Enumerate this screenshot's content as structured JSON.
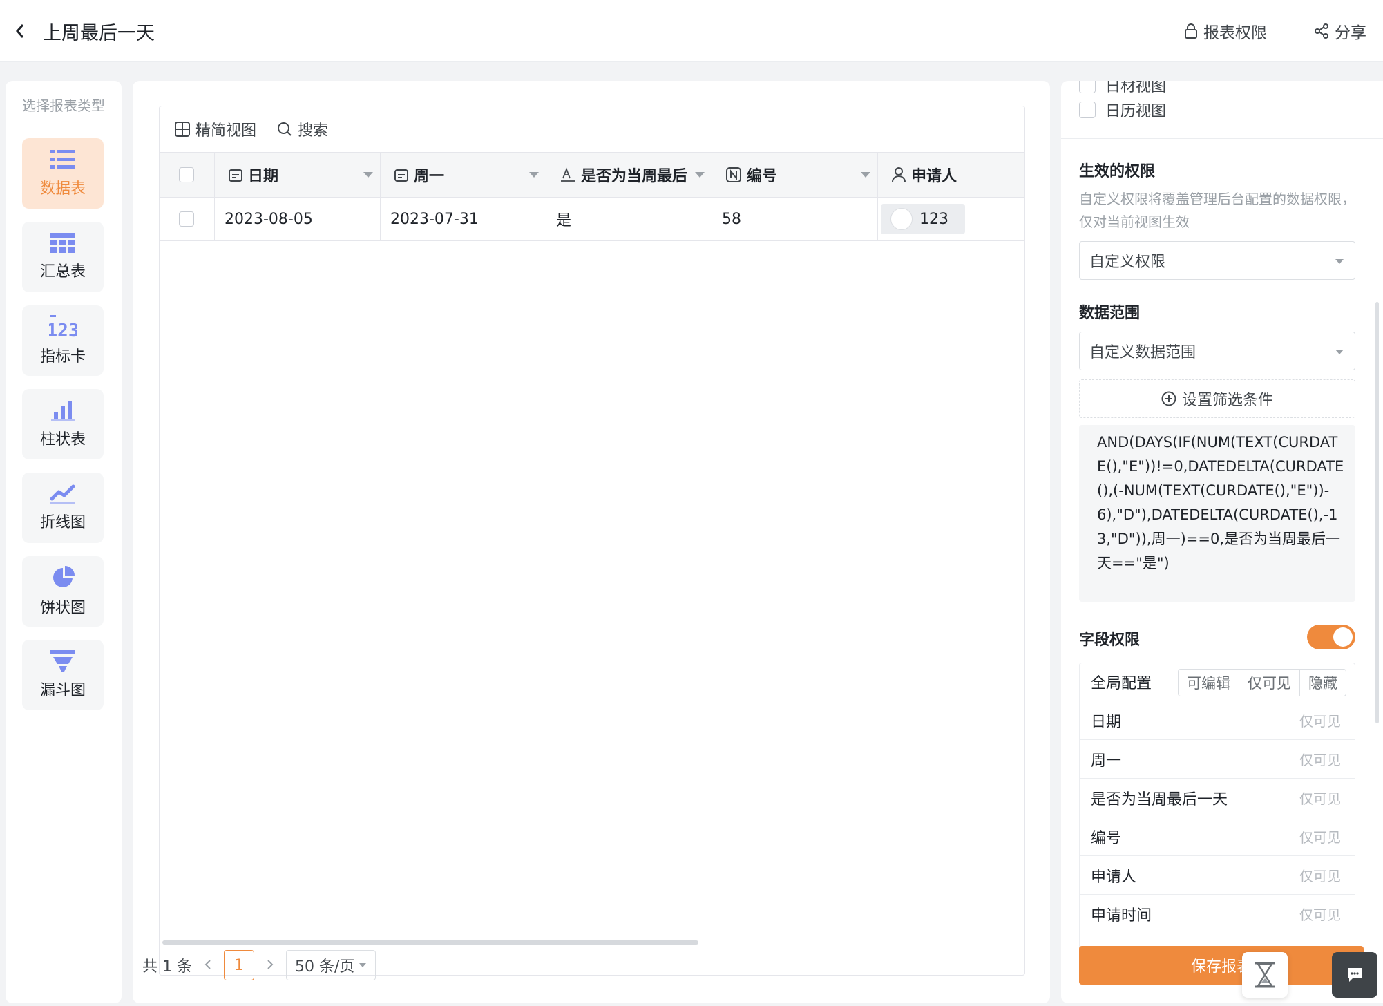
{
  "header": {
    "title": "上周最后一天",
    "report_permission_label": "报表权限",
    "share_label": "分享"
  },
  "sidebar": {
    "title": "选择报表类型",
    "items": [
      {
        "label": "数据表",
        "icon": "list-icon",
        "active": true
      },
      {
        "label": "汇总表",
        "icon": "table-icon",
        "active": false
      },
      {
        "label": "指标卡",
        "icon": "number-icon",
        "active": false
      },
      {
        "label": "柱状表",
        "icon": "bar-chart-icon",
        "active": false
      },
      {
        "label": "折线图",
        "icon": "line-chart-icon",
        "active": false
      },
      {
        "label": "饼状图",
        "icon": "pie-chart-icon",
        "active": false
      },
      {
        "label": "漏斗图",
        "icon": "funnel-icon",
        "active": false
      }
    ]
  },
  "toolbar": {
    "compact_view_label": "精简视图",
    "search_label": "搜索"
  },
  "table": {
    "columns": [
      {
        "label": "日期",
        "icon": "calendar-icon"
      },
      {
        "label": "周一",
        "icon": "calendar-icon"
      },
      {
        "label": "是否为当周最后",
        "icon": "text-icon"
      },
      {
        "label": "编号",
        "icon": "number-field-icon"
      },
      {
        "label": "申请人",
        "icon": "user-icon"
      }
    ],
    "rows": [
      {
        "date": "2023-08-05",
        "monday": "2023-07-31",
        "is_last_day": "是",
        "number": "58",
        "applicant": "123"
      }
    ]
  },
  "pagination": {
    "total_label": "共 1 条",
    "current_page": "1",
    "page_size": "50 条/页"
  },
  "right_panel": {
    "partial_checkbox_label": "日材视图",
    "calendar_view_label": "日历视图",
    "effective_permission": {
      "title": "生效的权限",
      "description": "自定义权限将覆盖管理后台配置的数据权限，仅对当前视图生效",
      "selected": "自定义权限"
    },
    "data_scope": {
      "title": "数据范围",
      "selected": "自定义数据范围",
      "filter_button_label": "设置筛选条件",
      "formula": "AND(DAYS(IF(NUM(TEXT(CURDATE(),\"E\"))!=0,DATEDELTA(CURDATE(),(-NUM(TEXT(CURDATE(),\"E\"))-6),\"D\"),DATEDELTA(CURDATE(),-13,\"D\")),周一)==0,是否为当周最后一天==\"是\")"
    },
    "field_permission": {
      "title": "字段权限",
      "enabled": true,
      "global_label": "全局配置",
      "modes": [
        "可编辑",
        "仅可见",
        "隐藏"
      ],
      "fields": [
        {
          "name": "日期",
          "value": "仅可见"
        },
        {
          "name": "周一",
          "value": "仅可见"
        },
        {
          "name": "是否为当周最后一天",
          "value": "仅可见"
        },
        {
          "name": "编号",
          "value": "仅可见"
        },
        {
          "name": "申请人",
          "value": "仅可见"
        },
        {
          "name": "申请时间",
          "value": "仅可见"
        }
      ]
    },
    "save_label": "保存报表"
  },
  "colors": {
    "accent": "#ef8a3d",
    "accent_light": "#fde5d4",
    "icon_blue": "#7b8cf0"
  }
}
